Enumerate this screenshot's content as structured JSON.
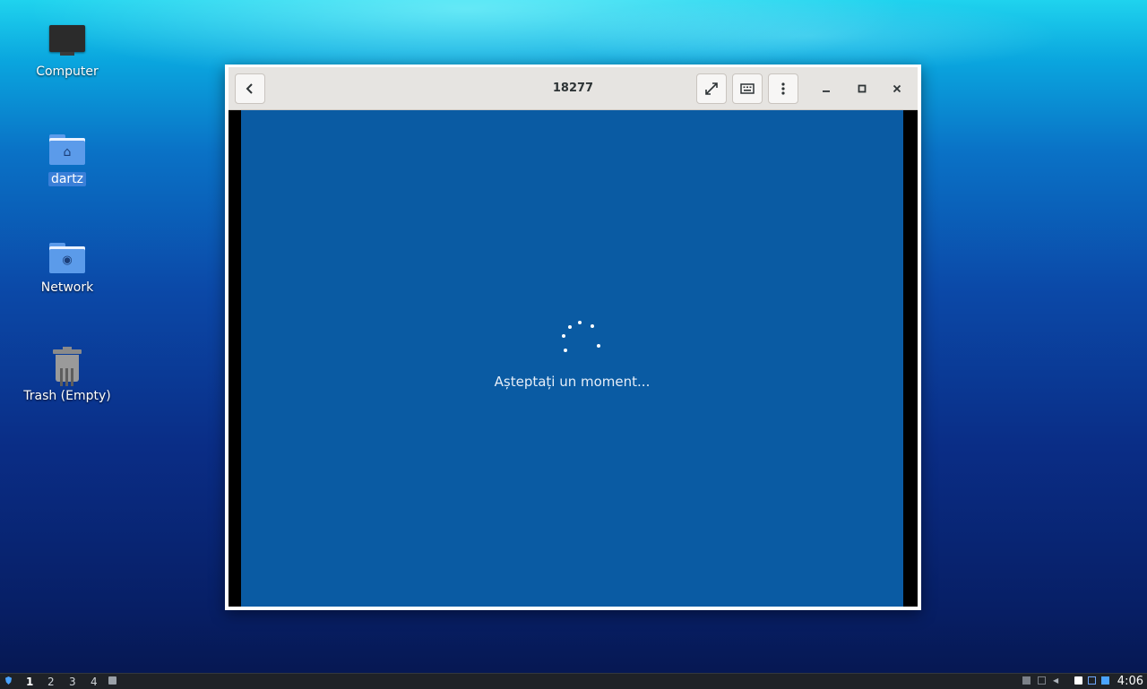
{
  "desktop": {
    "icons": [
      {
        "label": "Computer"
      },
      {
        "label": "dartz"
      },
      {
        "label": "Network"
      },
      {
        "label": "Trash (Empty)"
      }
    ]
  },
  "window": {
    "title": "18277",
    "buttons": {
      "back": "back-arrow-icon",
      "fullscreen": "fullscreen-icon",
      "keyboard": "keyboard-icon",
      "menu": "more-options-icon"
    },
    "controls": [
      "minimize",
      "maximize",
      "close"
    ]
  },
  "vm_screen": {
    "message": "Așteptați un moment...",
    "background_color": "#0a5ba3"
  },
  "taskbar": {
    "workspaces": [
      "1",
      "2",
      "3",
      "4"
    ],
    "active_workspace": "1",
    "clock": "4:06"
  }
}
